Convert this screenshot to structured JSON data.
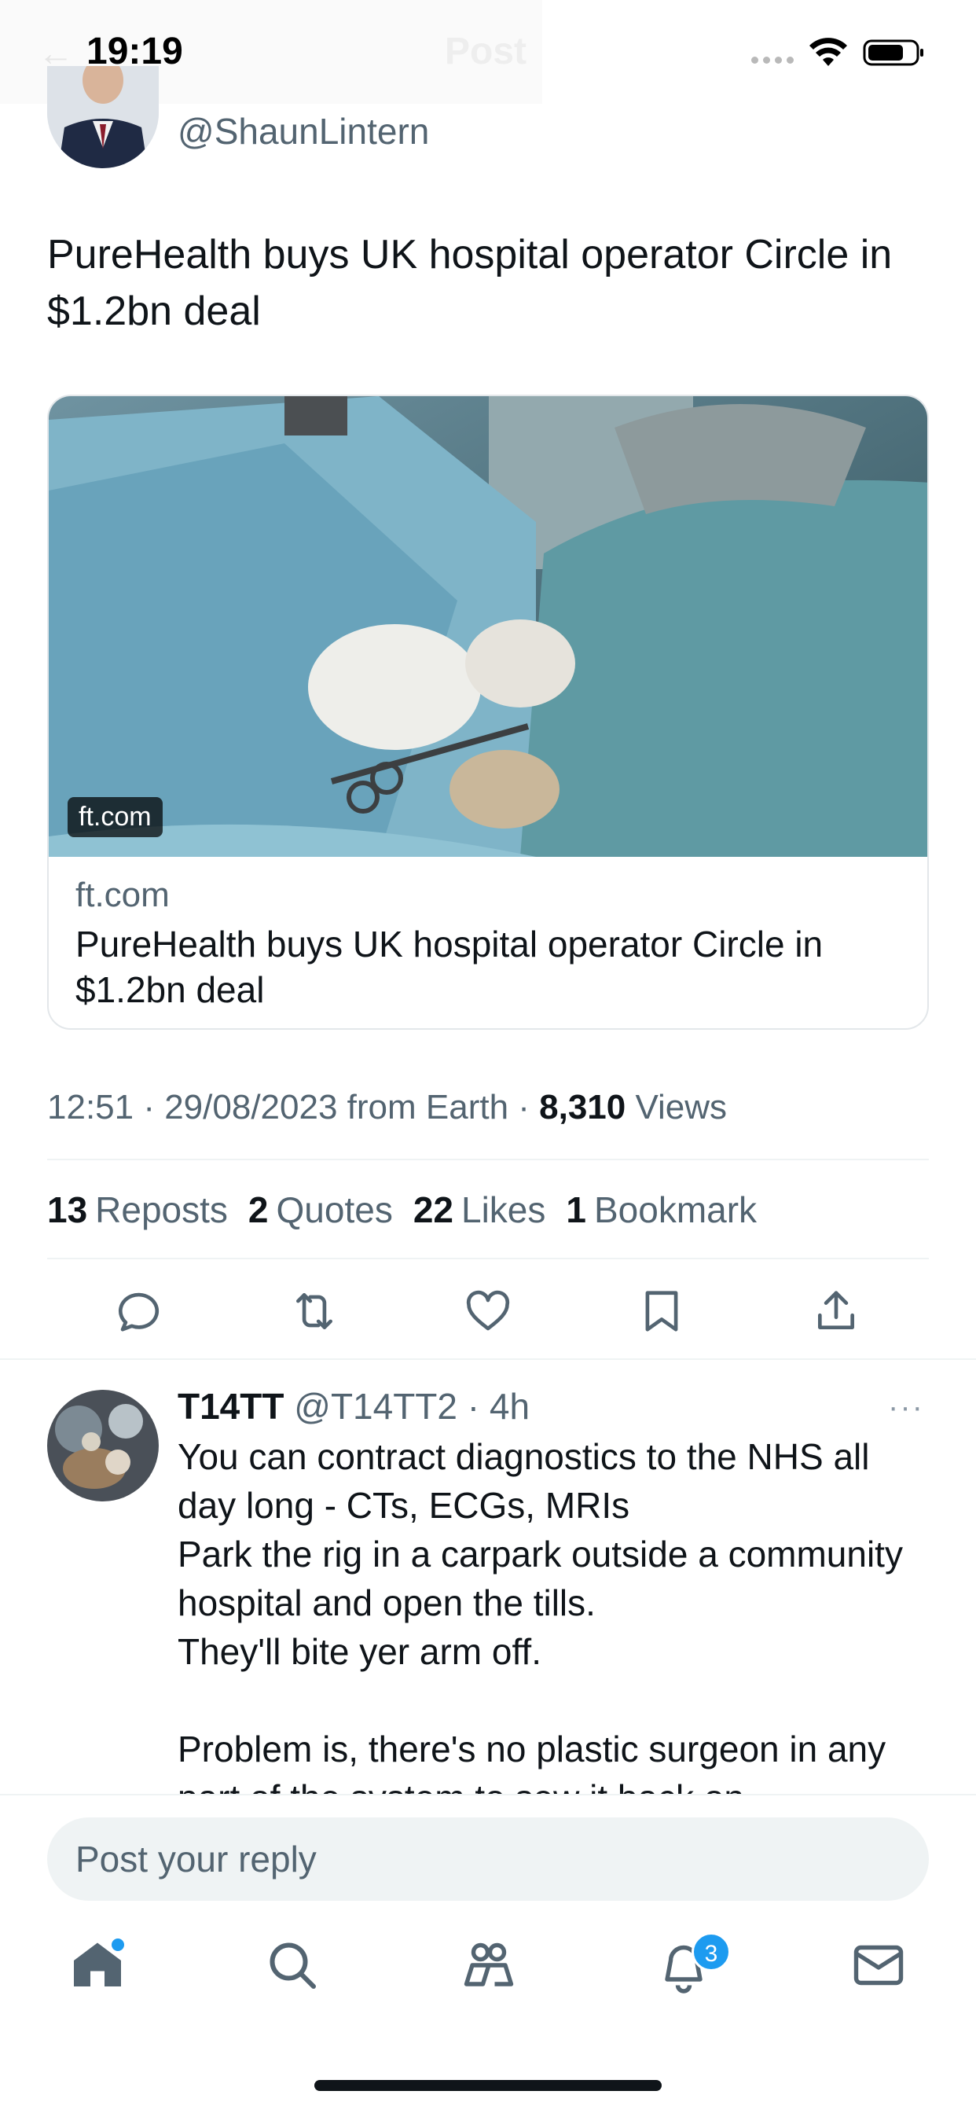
{
  "status": {
    "time": "19:19"
  },
  "header": {
    "title": "Post",
    "back_icon": "back-arrow-icon"
  },
  "author": {
    "handle": "@ShaunLintern"
  },
  "tweet": {
    "text": "PureHealth buys UK hospital operator Circle in $1.2bn deal"
  },
  "card": {
    "image_badge": "ft.com",
    "domain": "ft.com",
    "title": "PureHealth buys UK hospital operator Circle in $1.2bn deal"
  },
  "meta": {
    "time_date": "12:51 · 29/08/2023 from Earth · ",
    "views_count": "8,310",
    "views_label": " Views"
  },
  "stats": [
    {
      "count": "13",
      "label": "Reposts"
    },
    {
      "count": "2",
      "label": "Quotes"
    },
    {
      "count": "22",
      "label": "Likes"
    },
    {
      "count": "1",
      "label": "Bookmark"
    }
  ],
  "actions": [
    "reply-icon",
    "repost-icon",
    "like-icon",
    "bookmark-icon",
    "share-icon"
  ],
  "reply": {
    "name": "T14TT",
    "handle_time": " @T14TT2 · 4h",
    "more": "···",
    "body": "You can contract diagnostics to the NHS all day long - CTs, ECGs, MRIs\nPark the rig in a carpark outside a community hospital and open the tills.\nThey'll bite yer arm off.\n\nProblem is, there's no plastic surgeon in any part of the system to sew it back on."
  },
  "composer": {
    "placeholder": "Post your reply"
  },
  "tabbar": {
    "items": [
      "home-icon",
      "search-icon",
      "communities-icon",
      "notifications-icon",
      "messages-icon"
    ],
    "notification_count": "3"
  },
  "colors": {
    "accent": "#1d9bf0",
    "secondary_text": "#536471",
    "divider": "#eff3f4"
  }
}
